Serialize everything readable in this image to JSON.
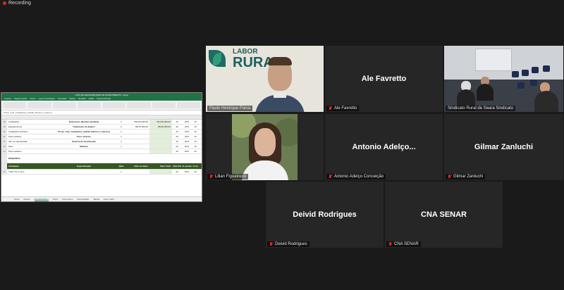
{
  "recording": {
    "label": "Recording"
  },
  "excel": {
    "title": "LISTA DE NECESSIDADES DE INVESTIMENTO - Excel",
    "tabs": [
      "Arquivo",
      "Página Inicial",
      "Inserir",
      "Layout da Página",
      "Fórmulas",
      "Dados",
      "Revisão",
      "Exibir",
      "Desenvolvedor"
    ],
    "formula": "Poste, rede, instalações, padrão (elétrico e externo)",
    "rows": [
      {
        "n": "18",
        "b": "Instalações",
        "d": "Exaustores (Bomba sanitária)",
        "e": "1",
        "f": "R$ 150.000,00",
        "g": "R$ 150.000,00",
        "h": "20",
        "i": "20%",
        "j": "10"
      },
      {
        "n": "19",
        "b": "Equipamentos",
        "d": "Tratamento de dejetos",
        "e": "2",
        "f": "R$ 45.000,00",
        "g": "R$ 90.000,00",
        "h": "20",
        "i": "20%",
        "j": "10"
      },
      {
        "n": "20",
        "b": "Instalações elétricas",
        "d": "Poste, rede, instalações, padrão (elétrico e externo)",
        "e": "1",
        "f": "",
        "g": "-",
        "h": "20",
        "i": "20%",
        "j": "10"
      },
      {
        "n": "21",
        "b": "Pisos aviários",
        "d": "Pisos aviarios",
        "e": "1",
        "f": "",
        "g": "-",
        "h": "20",
        "i": "20%",
        "j": "10"
      },
      {
        "n": "22",
        "b": "Sist. de desinfecção",
        "d": "Sistema de desinfecção",
        "e": "1",
        "f": "",
        "g": "-",
        "h": "15",
        "i": "20%",
        "j": "10"
      },
      {
        "n": "23",
        "b": "Silos",
        "d": "Balança",
        "e": "1",
        "f": "",
        "g": "-",
        "h": "20",
        "i": "20%",
        "j": "10"
      },
      {
        "n": "24",
        "b": "Pisos aviários",
        "d": "",
        "e": "",
        "f": "",
        "g": "-",
        "h": "20",
        "i": "20%",
        "j": "10"
      }
    ],
    "section": "MÁQUINAS",
    "header": {
      "b": "Instalação",
      "d": "Especificação",
      "e": "Qtde",
      "f": "Valor de Bens",
      "g": "Valor Total",
      "h": "Vida Útil (anos)",
      "i": "% sucata",
      "j": "% Ca"
    },
    "last_row": {
      "n": "31",
      "b": "Trator 75 cv sem",
      "e": "1",
      "g": "-",
      "h": "20",
      "i": "20%",
      "j": "10"
    },
    "sheets": [
      "Geral",
      "Custos",
      "Investimentos",
      "Fluxo",
      "Fluxo Novo",
      "Depreciação",
      "Tabela",
      "Fluxo Total"
    ],
    "active_sheet": "Investimentos"
  },
  "tiles": [
    {
      "label": "Paulo Henrique Paiva",
      "muted": false,
      "logo_top": "LABOR",
      "logo_bottom": "RURA"
    },
    {
      "name": "Ale Favretto",
      "label": "Ale Favretto",
      "muted": true
    },
    {
      "label": "Sindicato Rural de Seara Sindicato",
      "muted": false
    },
    {
      "label": "Lilian Figueiredo",
      "muted": true
    },
    {
      "name": "Antonio  Adelço...",
      "label": "Antonio Adelço Conceição",
      "muted": true
    },
    {
      "name": "Gilmar Zanluchi",
      "label": "Gilmar Zanluchi",
      "muted": true
    },
    {
      "name": "Deivid Rodrigues",
      "label": "Deivid Rodrigues",
      "muted": true
    },
    {
      "name": "CNA SENAR",
      "label": "CNA SENAR",
      "muted": true
    }
  ]
}
